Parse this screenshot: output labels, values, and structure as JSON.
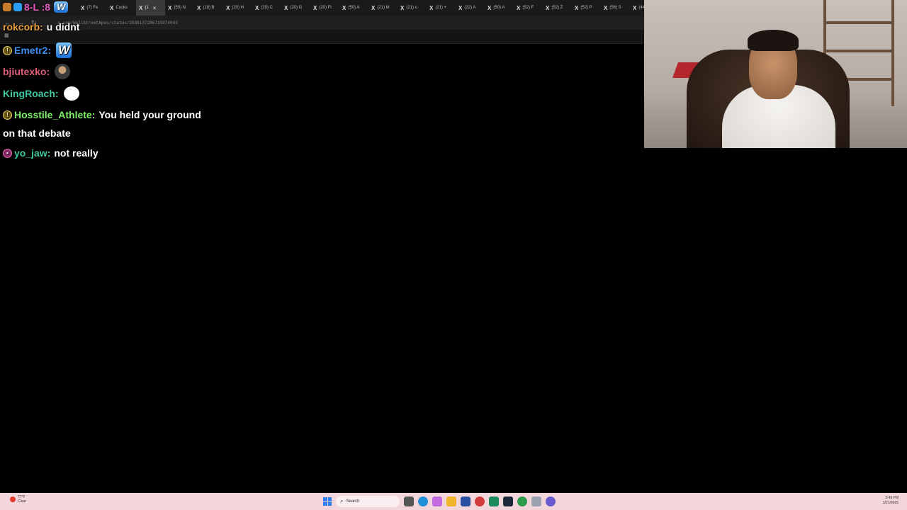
{
  "browser": {
    "tabs": [
      {
        "label": "(7) Fe"
      },
      {
        "label": "Cucks"
      },
      {
        "label": "(1",
        "active": true
      },
      {
        "label": "(50) N"
      },
      {
        "label": "(18) B"
      },
      {
        "label": "(20) H"
      },
      {
        "label": "(20) C"
      },
      {
        "label": "(20) G"
      },
      {
        "label": "(20) Fi"
      },
      {
        "label": "(50) A"
      },
      {
        "label": "(21) M"
      },
      {
        "label": "(21) o"
      },
      {
        "label": "(21) +"
      },
      {
        "label": "(22) A"
      },
      {
        "label": "(50) A"
      },
      {
        "label": "(52) F"
      },
      {
        "label": "(52) Z"
      },
      {
        "label": "(52) P"
      },
      {
        "label": "(56) S"
      },
      {
        "label": "(44)"
      }
    ],
    "tab_close": "×",
    "x_logo": "X",
    "url": "x.com/WallStreetApes/status/2035137286715974043"
  },
  "chat": {
    "top_name": "8-L :8",
    "messages": [
      {
        "user": "rokcorb:",
        "text": "u didnt",
        "color": "#e8a040"
      },
      {
        "user": "Emetr2:",
        "text": "",
        "color": "#3b8ef0",
        "emote": "W"
      },
      {
        "user": "bjiutexko:",
        "text": "",
        "color": "#e0607a"
      },
      {
        "user": "KingRoach:",
        "text": "",
        "color": "#40c8a0"
      },
      {
        "user": "Hosstile_Athlete:",
        "text": "You held your ground",
        "color": "#7ef06a"
      },
      {
        "user": "",
        "text": "on that debate",
        "color": "#ffffff"
      },
      {
        "user": "yo_jaw:",
        "text": "not really",
        "color": "#40c8a0"
      }
    ]
  },
  "taskbar": {
    "weather_temp": "77°F",
    "weather_desc": "Clear",
    "search_placeholder": "Search",
    "time": "3:49 PM",
    "date": "3/21/2026"
  }
}
